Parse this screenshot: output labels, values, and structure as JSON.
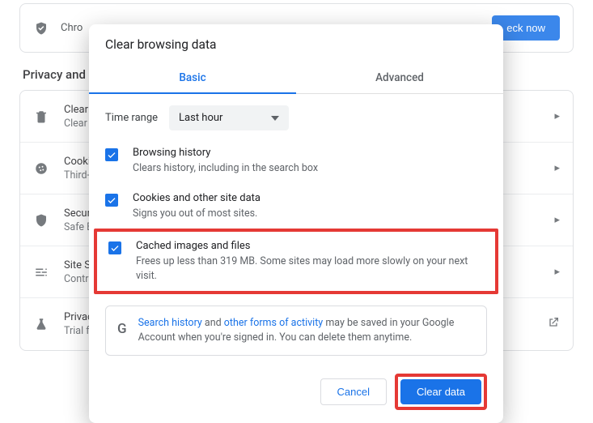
{
  "background": {
    "top_card_text": "Chro",
    "check_now_label": "eck now",
    "section_title": "Privacy and security",
    "rows": [
      {
        "title": "Clear browsing data",
        "sub": "Clear history, cookies, cache, and more",
        "icon": "trash"
      },
      {
        "title": "Cookies and other site data",
        "sub": "Third-party cookies are blocked in Incognito mode",
        "icon": "cookie"
      },
      {
        "title": "Security",
        "sub": "Safe Browsing (protection from dangerous sites) and other security settings",
        "icon": "shield"
      },
      {
        "title": "Site Settings",
        "sub": "Controls what information sites can use and show",
        "icon": "sliders"
      },
      {
        "title": "Privacy Sandbox",
        "sub": "Trial features are on",
        "icon": "flask"
      }
    ]
  },
  "dialog": {
    "title": "Clear browsing data",
    "tabs": {
      "basic": "Basic",
      "advanced": "Advanced"
    },
    "time_range_label": "Time range",
    "time_range_value": "Last hour",
    "options": [
      {
        "title": "Browsing history",
        "sub": "Clears history, including in the search box"
      },
      {
        "title": "Cookies and other site data",
        "sub": "Signs you out of most sites."
      },
      {
        "title": "Cached images and files",
        "sub": "Frees up less than 319 MB. Some sites may load more slowly on your next visit."
      }
    ],
    "info": {
      "link1": "Search history",
      "mid1": " and ",
      "link2": "other forms of activity",
      "rest": " may be saved in your Google Account when you're signed in. You can delete them anytime."
    },
    "cancel_label": "Cancel",
    "clear_label": "Clear data"
  }
}
